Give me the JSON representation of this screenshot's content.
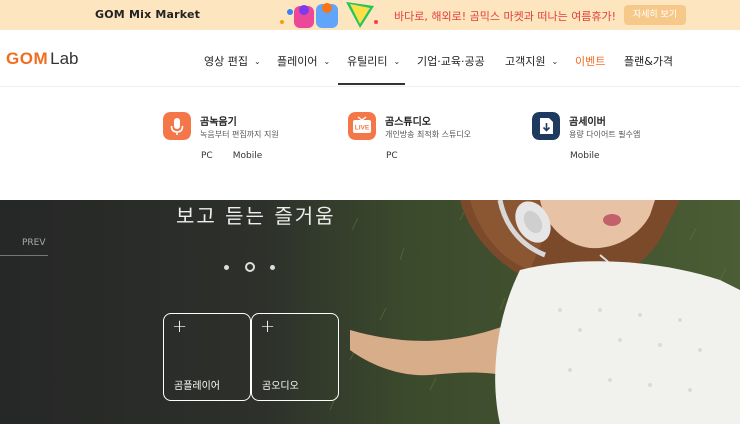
{
  "promo": {
    "logo": "GOM Mix Market",
    "text": "바다로, 해외로!  곰믹스 마켓과 떠나는 여름휴가!",
    "button": "자세히 보기"
  },
  "header": {
    "logo_a": "GOM",
    "logo_b": "Lab",
    "nav": [
      {
        "label": "영상 편집"
      },
      {
        "label": "플레이어"
      },
      {
        "label": "유틸리티"
      },
      {
        "label": "기업·교육·공공"
      },
      {
        "label": "고객지원"
      },
      {
        "label": "이벤트"
      },
      {
        "label": "플랜&가격"
      }
    ]
  },
  "dropdown": {
    "products": [
      {
        "name": "곰녹음기",
        "desc": "녹음부터 편집까지 지원",
        "links": [
          "PC",
          "Mobile"
        ],
        "icon": "microphone-icon"
      },
      {
        "name": "곰스튜디오",
        "desc": "개인방송 최적화 스튜디오",
        "links": [
          "PC"
        ],
        "icon": "live-icon"
      },
      {
        "name": "곰세이버",
        "desc": "용량 다이어트 필수앱",
        "links": [
          "Mobile"
        ],
        "icon": "sd-card-download-icon"
      }
    ],
    "live_badge": "LIVE"
  },
  "hero": {
    "headline": "보고 듣는 즐거움",
    "prev": "PREV",
    "cards": [
      {
        "label": "곰플레이어"
      },
      {
        "label": "곰오디오"
      }
    ]
  },
  "colors": {
    "accent": "#f26d21",
    "promo_bg": "#fde6bf",
    "promo_text": "#e0413a",
    "icon_orange": "#f4774a",
    "icon_navy": "#1f3a5f"
  }
}
